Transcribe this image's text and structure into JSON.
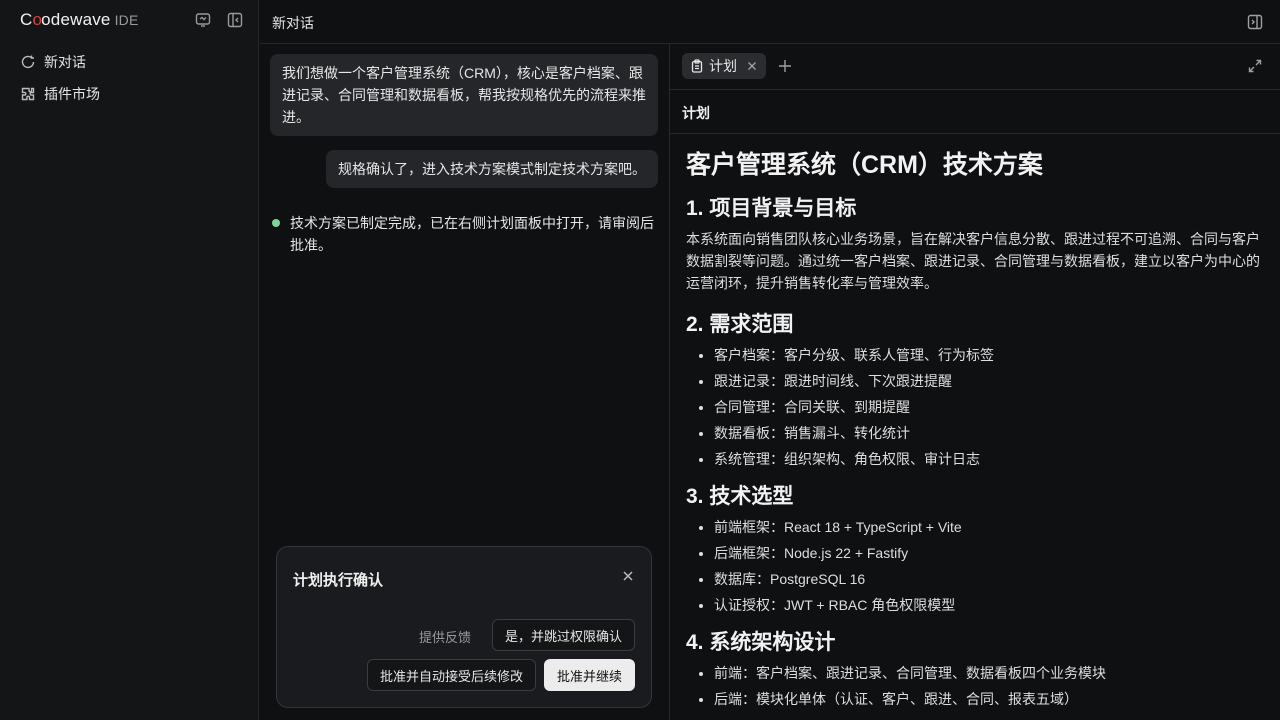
{
  "app": {
    "logo_main_a": "C",
    "logo_main_b": "odewave",
    "logo_ide": "IDE"
  },
  "sidebar": {
    "items": [
      {
        "label": "新对话",
        "icon": "new-chat-icon"
      },
      {
        "label": "插件市场",
        "icon": "plugin-icon"
      }
    ]
  },
  "header": {
    "title": "新对话"
  },
  "chat": {
    "user_message_1": "我们想做一个客户管理系统（CRM），核心是客户档案、跟进记录、合同管理和数据看板，帮我按规格优先的流程来推进。",
    "user_message_2": "规格确认了，进入技术方案模式制定技术方案吧。",
    "assistant_message": "技术方案已制定完成，已在右侧计划面板中打开，请审阅后批准。"
  },
  "confirm_card": {
    "title": "计划执行确认",
    "feedback_label": "提供反馈",
    "skip_permission_label": "是，并跳过权限确认",
    "auto_accept_label": "批准并自动接受后续修改",
    "approve_label": "批准并继续"
  },
  "panel": {
    "tab_label": "计划",
    "subheader": "计划",
    "doc": {
      "title": "客户管理系统（CRM）技术方案",
      "s1_heading": "1. 项目背景与目标",
      "s1_para": "本系统面向销售团队核心业务场景，旨在解决客户信息分散、跟进过程不可追溯、合同与客户数据割裂等问题。通过统一客户档案、跟进记录、合同管理与数据看板，建立以客户为中心的运营闭环，提升销售转化率与管理效率。",
      "s2_heading": "2. 需求范围",
      "s2_items": [
        "客户档案：客户分级、联系人管理、行为标签",
        "跟进记录：跟进时间线、下次跟进提醒",
        "合同管理：合同关联、到期提醒",
        "数据看板：销售漏斗、转化统计",
        "系统管理：组织架构、角色权限、审计日志"
      ],
      "s3_heading": "3. 技术选型",
      "s3_items": [
        "前端框架：React 18 + TypeScript + Vite",
        "后端框架：Node.js 22 + Fastify",
        "数据库：PostgreSQL 16",
        "认证授权：JWT + RBAC 角色权限模型"
      ],
      "s4_heading": "4. 系统架构设计",
      "s4_items": [
        "前端：客户档案、跟进记录、合同管理、数据看板四个业务模块",
        "后端：模块化单体（认证、客户、跟进、合同、报表五域）"
      ]
    }
  },
  "colors": {
    "accent_dot": "#7fd49a",
    "logo_o": "#e23b3b",
    "primary_button": "#ececec"
  }
}
